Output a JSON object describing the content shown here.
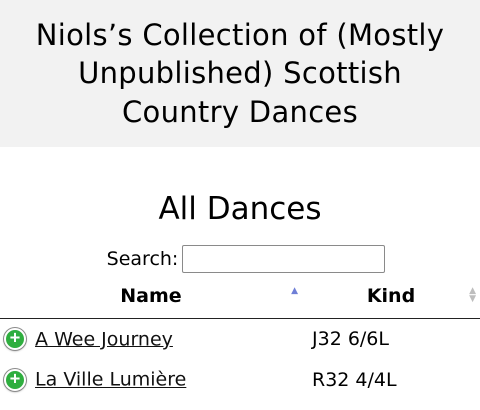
{
  "site_title": "Niols’s Collection of (Mostly Unpublished) Scottish Country Dances",
  "page_heading": "All Dances",
  "search": {
    "label": "Search:",
    "value": "",
    "placeholder": ""
  },
  "table": {
    "columns": [
      "Name",
      "Kind"
    ],
    "sort": {
      "column": "Name",
      "direction": "ascending"
    },
    "rows": [
      {
        "name": "A Wee Journey",
        "kind": "J32 6/6L"
      },
      {
        "name": "La Ville Lumière",
        "kind": "R32 4/4L"
      }
    ]
  },
  "icons": {
    "expand": "plus-circle-icon",
    "sort_active": "sort-asc-icon",
    "sort_inactive": "sort-both-icon"
  },
  "colors": {
    "header_bg": "#f2f2f2",
    "expand_icon": "#2fae3f",
    "sort_active": "#6f7fd6"
  }
}
